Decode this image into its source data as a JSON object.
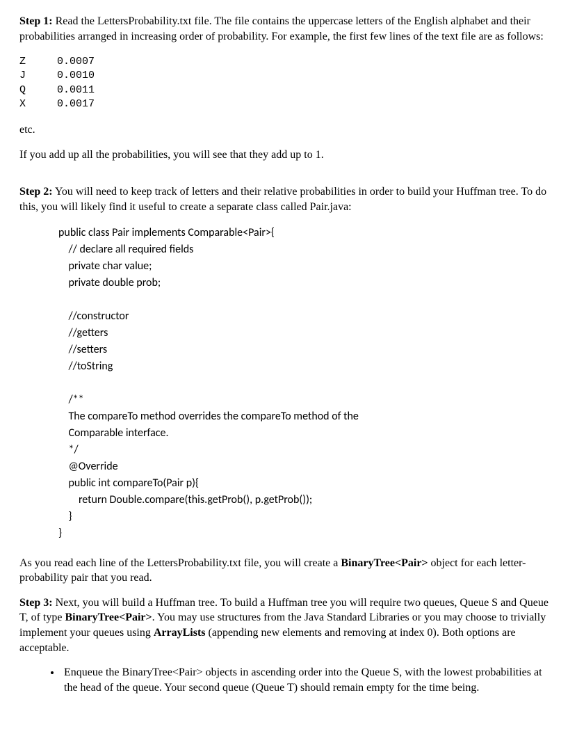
{
  "step1": {
    "label": "Step 1:",
    "text": " Read the LettersProbability.txt file. The file contains the uppercase letters of the English alphabet and their probabilities arranged in increasing order of probability. For example, the first few lines of the text file are as follows:"
  },
  "probTable": "Z     0.0007\nJ     0.0010\nQ     0.0011\nX     0.0017",
  "etc": "etc.",
  "sumNote": "If you add up all the probabilities, you will see that they add up to 1.",
  "step2": {
    "label": "Step 2:",
    "text": " You will need to keep track of letters and their relative probabilities in order to build your Huffman tree. To do this, you will likely find it useful to create a separate class called Pair.java:"
  },
  "codeBlock": "public class Pair implements Comparable<Pair>{\n    // declare all required fields\n    private char value;\n    private double prob;\n\n    //constructor\n    //getters\n    //setters\n    //toString\n\n    /**\n    The compareTo method overrides the compareTo method of the\n    Comparable interface.\n    */\n    @Override\n    public int compareTo(Pair p){\n        return Double.compare(this.getProb(), p.getProb());\n    }\n}",
  "afterCode": {
    "pre": "As you read each line of the LettersProbability.txt file, you will create a ",
    "bold1": "BinaryTree<Pair>",
    "post": " object for each letter-probability pair that you read."
  },
  "step3": {
    "label": "Step 3:",
    "text1": " Next, you will build a Huffman tree. To build a Huffman tree you will require two queues, Queue S and Queue T, of type ",
    "bold1": "BinaryTree<Pair>",
    "text2": ". You may use structures from the Java Standard Libraries or you may choose to trivially implement your queues using ",
    "bold2": "ArrayLists",
    "text3": " (appending new elements and removing at index 0). Both options are acceptable."
  },
  "bullet1": "Enqueue the BinaryTree<Pair> objects in ascending order into the Queue S, with the lowest probabilities at the head of the queue. Your second queue (Queue T) should remain empty for the time being."
}
